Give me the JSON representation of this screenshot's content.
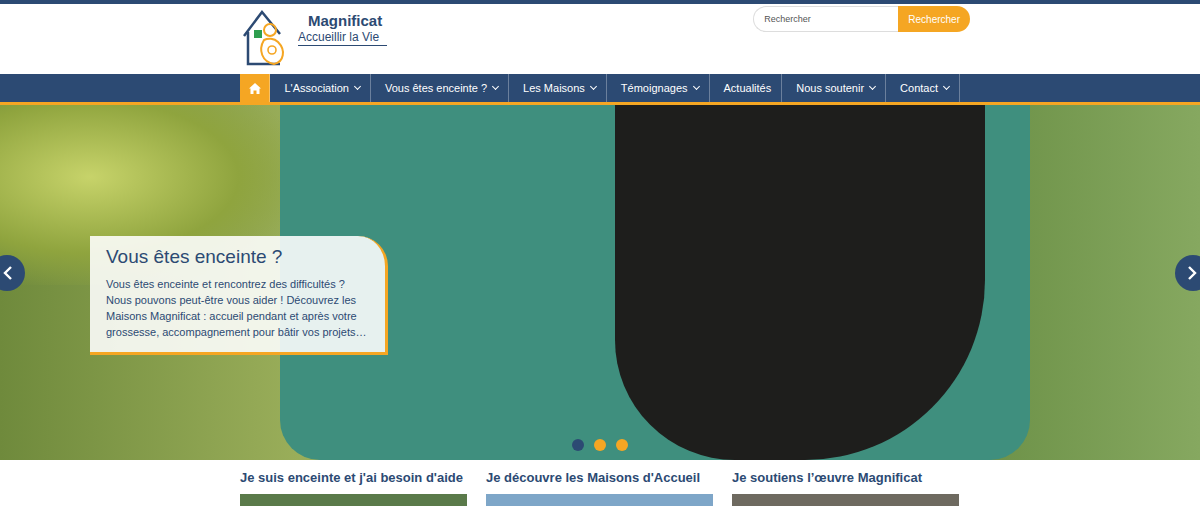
{
  "logo": {
    "name": "Magnificat",
    "tagline": "Accueillir la Vie"
  },
  "search": {
    "placeholder": "Rechercher",
    "button": "Rechercher"
  },
  "home": {
    "selected": true
  },
  "nav": [
    {
      "label": "L'Association",
      "has_menu": true,
      "selected": false
    },
    {
      "label": "Vous êtes enceinte ?",
      "has_menu": true,
      "selected": false
    },
    {
      "label": "Les Maisons",
      "has_menu": true,
      "selected": false
    },
    {
      "label": "Témoignages",
      "has_menu": true,
      "selected": false
    },
    {
      "label": "Actualités",
      "has_menu": false,
      "selected": false
    },
    {
      "label": "Nous soutenir",
      "has_menu": true,
      "selected": false
    },
    {
      "label": "Contact",
      "has_menu": true,
      "selected": false
    }
  ],
  "slider": {
    "title": "Vous êtes enceinte ?",
    "text": "Vous êtes enceinte et rencontrez des difficultés ? Nous pouvons peut-être vous aider ! Découvrez les Maisons Magnificat : accueil pendant et après votre grossesse, accompagnement pour bâtir vos projets…",
    "dots": [
      {
        "selected": true
      },
      {
        "selected": false
      },
      {
        "selected": false
      }
    ]
  },
  "features": [
    {
      "title": "Je suis enceinte et j'ai besoin d'aide"
    },
    {
      "title": "Je découvre les Maisons d'Accueil"
    },
    {
      "title": "Je soutiens l’œuvre Magnificat"
    }
  ]
}
